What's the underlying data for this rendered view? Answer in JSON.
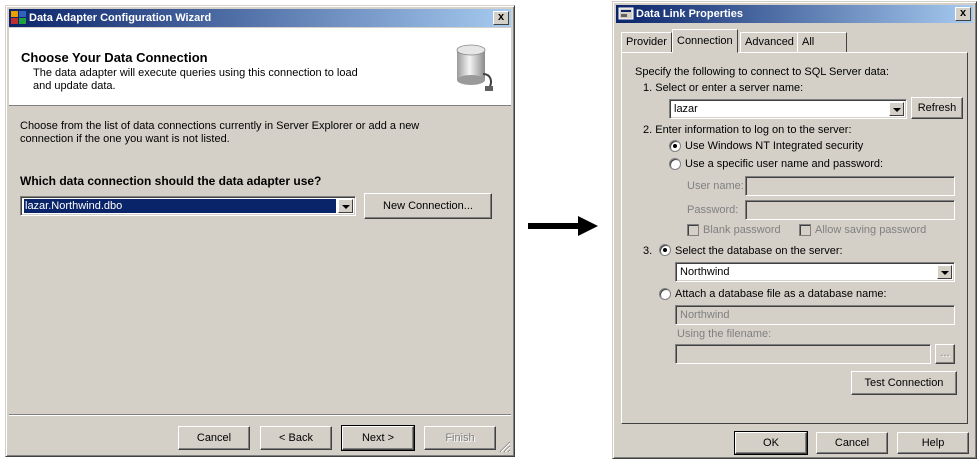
{
  "wizard": {
    "title": "Data Adapter Configuration Wizard",
    "header_title": "Choose Your Data Connection",
    "header_desc_line1": "The data adapter will execute queries using this connection to load",
    "header_desc_line2": "and update data.",
    "instruction_line1": "Choose from the list of data connections currently in Server Explorer or add a new",
    "instruction_line2": "connection if the one you want is not listed.",
    "question": "Which data connection should the data adapter use?",
    "connection_value": "lazar.Northwind.dbo",
    "new_connection_label": "New Connection...",
    "cancel_label": "Cancel",
    "back_label": "< Back",
    "next_label": "Next >",
    "finish_label": "Finish",
    "close_label": "x"
  },
  "dlp": {
    "title": "Data Link Properties",
    "close_label": "x",
    "tabs": [
      "Provider",
      "Connection",
      "Advanced",
      "All"
    ],
    "intro": "Specify the following to connect to SQL Server data:",
    "step1": "1. Select or enter a server name:",
    "server_value": "lazar",
    "refresh_label": "Refresh",
    "step2": "2. Enter information to log on to the server:",
    "radio_nt": "Use Windows NT Integrated security",
    "radio_specific": "Use a specific user name and password:",
    "username_label": "User name:",
    "password_label": "Password:",
    "blank_password": "Blank password",
    "allow_saving": "Allow saving password",
    "step3_num": "3.",
    "radio_select_db": "Select the database on the server:",
    "database_value": "Northwind",
    "radio_attach": "Attach a database file as a database name:",
    "attach_name_value": "Northwind",
    "filename_label": "Using the filename:",
    "browse_label": "...",
    "test_connection_label": "Test Connection",
    "ok_label": "OK",
    "cancel_label": "Cancel",
    "help_label": "Help"
  }
}
